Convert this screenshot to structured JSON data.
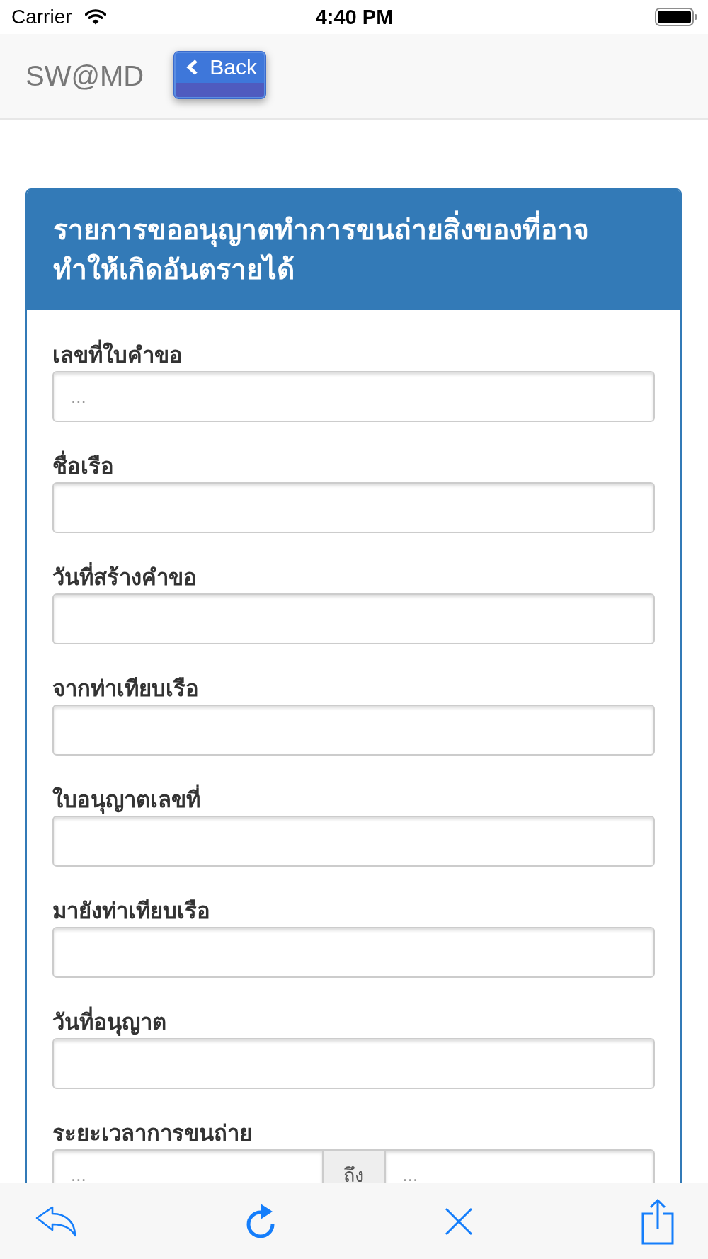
{
  "status_bar": {
    "carrier": "Carrier",
    "time": "4:40 PM"
  },
  "nav_bar": {
    "brand": "SW@MD",
    "back_button": {
      "label": "Back"
    }
  },
  "panel": {
    "title": "รายการขออนุญาตทำการขนถ่ายสิ่งของที่อาจทำให้เกิดอันตรายได้",
    "fields": [
      {
        "kind": "text",
        "label": "เลขที่ใบคำขอ",
        "placeholder": "..."
      },
      {
        "kind": "text",
        "label": "ชื่อเรือ"
      },
      {
        "kind": "text",
        "label": "วันที่สร้างคำขอ"
      },
      {
        "kind": "text",
        "label": "จากท่าเทียบเรือ"
      },
      {
        "kind": "text",
        "label": "ใบอนุญาตเลขที่"
      },
      {
        "kind": "text",
        "label": "มายังท่าเทียบเรือ"
      },
      {
        "kind": "text",
        "label": "วันที่อนุญาต"
      },
      {
        "kind": "range",
        "label": "ระยะเวลาการขนถ่าย",
        "from_placeholder": "...",
        "separator": "ถึง",
        "to_placeholder": "..."
      }
    ]
  }
}
